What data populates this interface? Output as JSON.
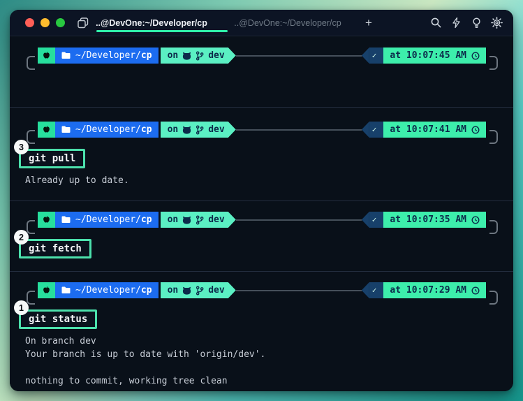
{
  "tab_bar": {
    "active_tab": "..@DevOne:~/Developer/cp",
    "inactive_tab": "..@DevOne:~/Developer/cp",
    "new_tab_label": "+"
  },
  "prompt": {
    "path_prefix": "~/Developer/",
    "path_dir": "cp",
    "on_label": "on",
    "branch": "dev",
    "check_glyph": "✓"
  },
  "blocks": [
    {
      "time": "at 10:07:45 AM"
    },
    {
      "time": "at 10:07:41 AM",
      "badge": "3",
      "command": "git pull",
      "output": [
        "Already up to date."
      ]
    },
    {
      "time": "at 10:07:35 AM",
      "badge": "2",
      "command": "git fetch"
    },
    {
      "time": "at 10:07:29 AM",
      "badge": "1",
      "command": "git status",
      "output": [
        "On branch dev",
        "Your branch is up to date with 'origin/dev'.",
        "",
        "nothing to commit, working tree clean"
      ]
    }
  ],
  "icons": {
    "window_copy": "overlapping-windows",
    "search": "magnifier",
    "bolt": "lightning",
    "bulb": "lightbulb",
    "gear": "settings",
    "apple": "apple-logo",
    "folder": "folder",
    "github": "octocat",
    "git_branch": "branch",
    "clock": "clock"
  },
  "colors": {
    "window_bg": "#0a1120",
    "terminal_bg": "#091019",
    "tab_underline": "#2ff0a9",
    "segment_apple_bg": "#27df9d",
    "segment_path_bg": "#1c6cf0",
    "segment_branch_bg": "#5bf0c3",
    "segment_time_bg": "#3deeab",
    "segment_check_bg": "#17406a",
    "command_box_border": "#4ce1ac",
    "traffic_red": "#ff5f57",
    "traffic_yellow": "#febc2e",
    "traffic_green": "#28c840"
  }
}
